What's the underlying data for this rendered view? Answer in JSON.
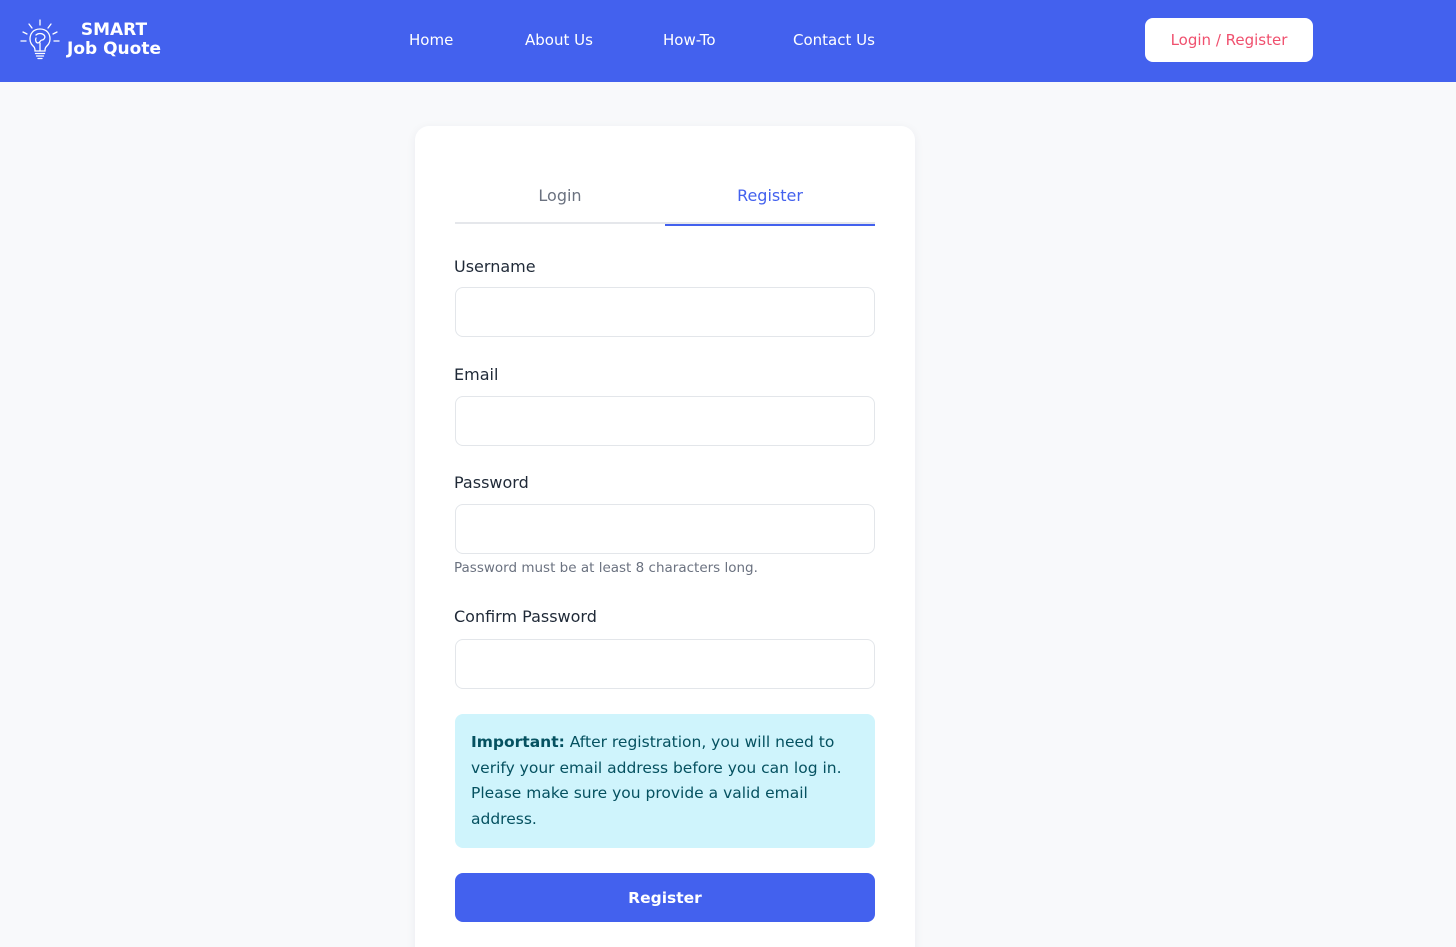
{
  "brand": {
    "line1": "SMART",
    "line2": "Job Quote",
    "icon": "lightbulb-brain-icon"
  },
  "nav": {
    "items": [
      {
        "label": "Home"
      },
      {
        "label": "About Us"
      },
      {
        "label": "How-To"
      },
      {
        "label": "Contact Us"
      }
    ],
    "auth_label": "Login / Register"
  },
  "tabs": [
    {
      "label": "Login",
      "active": false
    },
    {
      "label": "Register",
      "active": true
    }
  ],
  "form": {
    "username": {
      "label": "Username",
      "value": "",
      "placeholder": ""
    },
    "email": {
      "label": "Email",
      "value": "",
      "placeholder": ""
    },
    "password": {
      "label": "Password",
      "value": "",
      "placeholder": "",
      "hint": "Password must be at least 8 characters long."
    },
    "confirm_password": {
      "label": "Confirm Password",
      "value": "",
      "placeholder": ""
    },
    "notice": {
      "bold": "Important:",
      "text": " After registration, you will need to verify your email address before you can log in. Please make sure you provide a valid email address."
    },
    "submit_label": "Register"
  },
  "colors": {
    "primary": "#4361ee",
    "accent": "#f0506e",
    "notice_bg": "#cff4fc",
    "notice_text": "#055160",
    "page_bg": "#f8f9fb"
  }
}
